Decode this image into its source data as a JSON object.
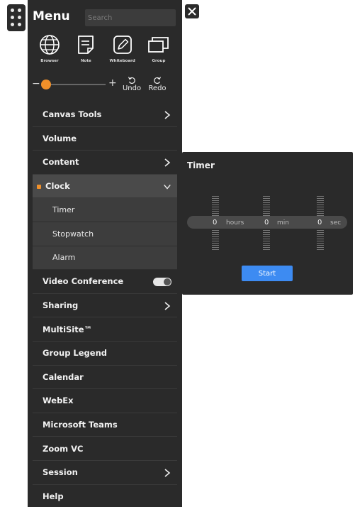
{
  "menu": {
    "title": "Menu",
    "search_placeholder": "Search",
    "apps": [
      {
        "label": "Browser",
        "icon": "globe-icon"
      },
      {
        "label": "Note",
        "icon": "note-icon"
      },
      {
        "label": "Whiteboard",
        "icon": "whiteboard-icon"
      },
      {
        "label": "Group",
        "icon": "group-icon"
      }
    ],
    "zoom": {
      "minus": "−",
      "plus": "+",
      "level": 0.05
    },
    "undo_label": "Undo",
    "redo_label": "Redo",
    "items": [
      {
        "label": "Canvas Tools",
        "chevron": true
      },
      {
        "label": "Volume"
      },
      {
        "label": "Content",
        "chevron": true
      },
      {
        "label": "Clock",
        "expanded": true
      },
      {
        "label": "Timer",
        "sub": true
      },
      {
        "label": "Stopwatch",
        "sub": true
      },
      {
        "label": "Alarm",
        "sub": true
      },
      {
        "label": "Video Conference",
        "toggle": true,
        "toggle_on": false
      },
      {
        "label": "Sharing",
        "chevron": true
      },
      {
        "label": "MultiSite™"
      },
      {
        "label": "Group Legend"
      },
      {
        "label": "Calendar"
      },
      {
        "label": "WebEx"
      },
      {
        "label": "Microsoft Teams"
      },
      {
        "label": "Zoom VC"
      },
      {
        "label": "Session",
        "chevron": true
      },
      {
        "label": "Help"
      }
    ]
  },
  "timer": {
    "title": "Timer",
    "hours": "0",
    "hours_unit": "hours",
    "min": "0",
    "min_unit": "min",
    "sec": "0",
    "sec_unit": "sec",
    "start_label": "Start"
  },
  "colors": {
    "accent": "#f0902a",
    "button": "#3d8bf2",
    "panel": "#2a2a2a"
  }
}
